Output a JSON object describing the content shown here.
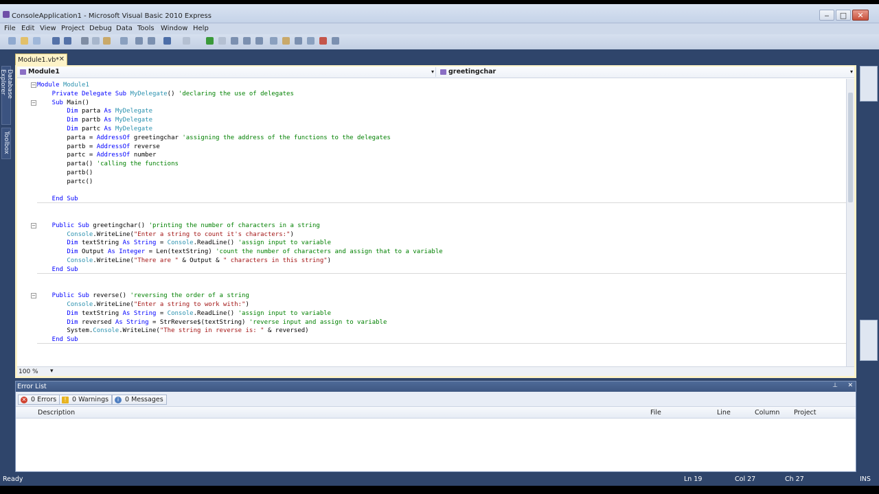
{
  "window": {
    "title": "ConsoleApplication1 - Microsoft Visual Basic 2010 Express",
    "min_label": "‒",
    "max_label": "□",
    "close_label": "✕"
  },
  "menu": [
    "File",
    "Edit",
    "View",
    "Project",
    "Debug",
    "Data",
    "Tools",
    "Window",
    "Help"
  ],
  "left_dock_tabs": [
    "Database Explorer",
    "Toolbox"
  ],
  "document_tab": {
    "label": "Module1.vb*",
    "close": "✕"
  },
  "nav": {
    "left_label": "Module1",
    "right_label": "greetingchar",
    "dropdown": "▾"
  },
  "code_lines": [
    {
      "tokens": [
        {
          "c": "kw",
          "t": "Module "
        },
        {
          "c": "ty",
          "t": "Module1"
        }
      ]
    },
    {
      "tokens": [
        {
          "c": "kw",
          "t": "    Private Delegate Sub "
        },
        {
          "c": "ty",
          "t": "MyDelegate"
        },
        {
          "c": "tx",
          "t": "() "
        },
        {
          "c": "cm",
          "t": "'declaring the use of delegates"
        }
      ]
    },
    {
      "tokens": [
        {
          "c": "kw",
          "t": "    Sub "
        },
        {
          "c": "tx",
          "t": "Main()"
        }
      ]
    },
    {
      "tokens": [
        {
          "c": "kw",
          "t": "        Dim "
        },
        {
          "c": "tx",
          "t": "parta "
        },
        {
          "c": "kw",
          "t": "As "
        },
        {
          "c": "ty",
          "t": "MyDelegate"
        }
      ]
    },
    {
      "tokens": [
        {
          "c": "kw",
          "t": "        Dim "
        },
        {
          "c": "tx",
          "t": "partb "
        },
        {
          "c": "kw",
          "t": "As "
        },
        {
          "c": "ty",
          "t": "MyDelegate"
        }
      ]
    },
    {
      "tokens": [
        {
          "c": "kw",
          "t": "        Dim "
        },
        {
          "c": "tx",
          "t": "partc "
        },
        {
          "c": "kw",
          "t": "As "
        },
        {
          "c": "ty",
          "t": "MyDelegate"
        }
      ]
    },
    {
      "tokens": [
        {
          "c": "tx",
          "t": "        parta = "
        },
        {
          "c": "kw",
          "t": "AddressOf "
        },
        {
          "c": "tx",
          "t": "greetingchar "
        },
        {
          "c": "cm",
          "t": "'assigning the address of the functions to the delegates"
        }
      ]
    },
    {
      "tokens": [
        {
          "c": "tx",
          "t": "        partb = "
        },
        {
          "c": "kw",
          "t": "AddressOf "
        },
        {
          "c": "tx",
          "t": "reverse"
        }
      ]
    },
    {
      "tokens": [
        {
          "c": "tx",
          "t": "        partc = "
        },
        {
          "c": "kw",
          "t": "AddressOf "
        },
        {
          "c": "tx",
          "t": "number"
        }
      ]
    },
    {
      "tokens": [
        {
          "c": "tx",
          "t": "        parta() "
        },
        {
          "c": "cm",
          "t": "'calling the functions"
        }
      ]
    },
    {
      "tokens": [
        {
          "c": "tx",
          "t": "        partb()"
        }
      ]
    },
    {
      "tokens": [
        {
          "c": "tx",
          "t": "        partc()"
        }
      ]
    },
    {
      "tokens": []
    },
    {
      "tokens": [
        {
          "c": "kw",
          "t": "    End Sub"
        }
      ]
    },
    {
      "tokens": []
    },
    {
      "tokens": []
    },
    {
      "tokens": [
        {
          "c": "kw",
          "t": "    Public Sub "
        },
        {
          "c": "tx",
          "t": "greetingchar() "
        },
        {
          "c": "cm",
          "t": "'printing the number of characters in a string"
        }
      ]
    },
    {
      "tokens": [
        {
          "c": "ty",
          "t": "        Console"
        },
        {
          "c": "tx",
          "t": ".WriteLine("
        },
        {
          "c": "st",
          "t": "\"Enter a string to count it's characters:\""
        },
        {
          "c": "tx",
          "t": ")"
        }
      ]
    },
    {
      "tokens": [
        {
          "c": "kw",
          "t": "        Dim "
        },
        {
          "c": "tx",
          "t": "textString "
        },
        {
          "c": "kw",
          "t": "As String "
        },
        {
          "c": "tx",
          "t": "= "
        },
        {
          "c": "ty",
          "t": "Console"
        },
        {
          "c": "tx",
          "t": ".ReadLine() "
        },
        {
          "c": "cm",
          "t": "'assign input to variable"
        }
      ]
    },
    {
      "tokens": [
        {
          "c": "kw",
          "t": "        Dim "
        },
        {
          "c": "tx",
          "t": "Output "
        },
        {
          "c": "kw",
          "t": "As Integer "
        },
        {
          "c": "tx",
          "t": "= Len(textString) "
        },
        {
          "c": "cm",
          "t": "'count the number of characters and assign that to a variable"
        }
      ]
    },
    {
      "tokens": [
        {
          "c": "ty",
          "t": "        Console"
        },
        {
          "c": "tx",
          "t": ".WriteLine("
        },
        {
          "c": "st",
          "t": "\"There are \""
        },
        {
          "c": "tx",
          "t": " & Output & "
        },
        {
          "c": "st",
          "t": "\" characters in this string\""
        },
        {
          "c": "tx",
          "t": ")"
        }
      ]
    },
    {
      "tokens": [
        {
          "c": "kw",
          "t": "    End Sub"
        }
      ]
    },
    {
      "tokens": []
    },
    {
      "tokens": []
    },
    {
      "tokens": [
        {
          "c": "kw",
          "t": "    Public Sub "
        },
        {
          "c": "tx",
          "t": "reverse() "
        },
        {
          "c": "cm",
          "t": "'reversing the order of a string"
        }
      ]
    },
    {
      "tokens": [
        {
          "c": "ty",
          "t": "        Console"
        },
        {
          "c": "tx",
          "t": ".WriteLine("
        },
        {
          "c": "st",
          "t": "\"Enter a string to work with:\""
        },
        {
          "c": "tx",
          "t": ")"
        }
      ]
    },
    {
      "tokens": [
        {
          "c": "kw",
          "t": "        Dim "
        },
        {
          "c": "tx",
          "t": "textString "
        },
        {
          "c": "kw",
          "t": "As String "
        },
        {
          "c": "tx",
          "t": "= "
        },
        {
          "c": "ty",
          "t": "Console"
        },
        {
          "c": "tx",
          "t": ".ReadLine() "
        },
        {
          "c": "cm",
          "t": "'assign input to variable"
        }
      ]
    },
    {
      "tokens": [
        {
          "c": "kw",
          "t": "        Dim "
        },
        {
          "c": "tx",
          "t": "reversed "
        },
        {
          "c": "kw",
          "t": "As String "
        },
        {
          "c": "tx",
          "t": "= StrReverse$(textString) "
        },
        {
          "c": "cm",
          "t": "'reverse input and assign to variable"
        }
      ]
    },
    {
      "tokens": [
        {
          "c": "tx",
          "t": "        System."
        },
        {
          "c": "ty",
          "t": "Console"
        },
        {
          "c": "tx",
          "t": ".WriteLine("
        },
        {
          "c": "st",
          "t": "\"The string in reverse is: \""
        },
        {
          "c": "tx",
          "t": " & reversed)"
        }
      ]
    },
    {
      "tokens": [
        {
          "c": "kw",
          "t": "    End Sub"
        }
      ]
    }
  ],
  "editor_footer": {
    "zoom": "100 %"
  },
  "error_list": {
    "title": "Error List",
    "errors_btn": "0 Errors",
    "warnings_btn": "0 Warnings",
    "messages_btn": "0 Messages",
    "columns": [
      "Description",
      "File",
      "Line",
      "Column",
      "Project"
    ]
  },
  "status": {
    "ready": "Ready",
    "ln": "Ln 19",
    "col": "Col 27",
    "ch": "Ch 27",
    "ins": "INS"
  },
  "colors": {
    "keyword": "#0000ff",
    "type": "#2b91af",
    "comment": "#008000",
    "string": "#a31515",
    "chrome": "#2f456b",
    "active_tab": "#fdf3c8"
  }
}
